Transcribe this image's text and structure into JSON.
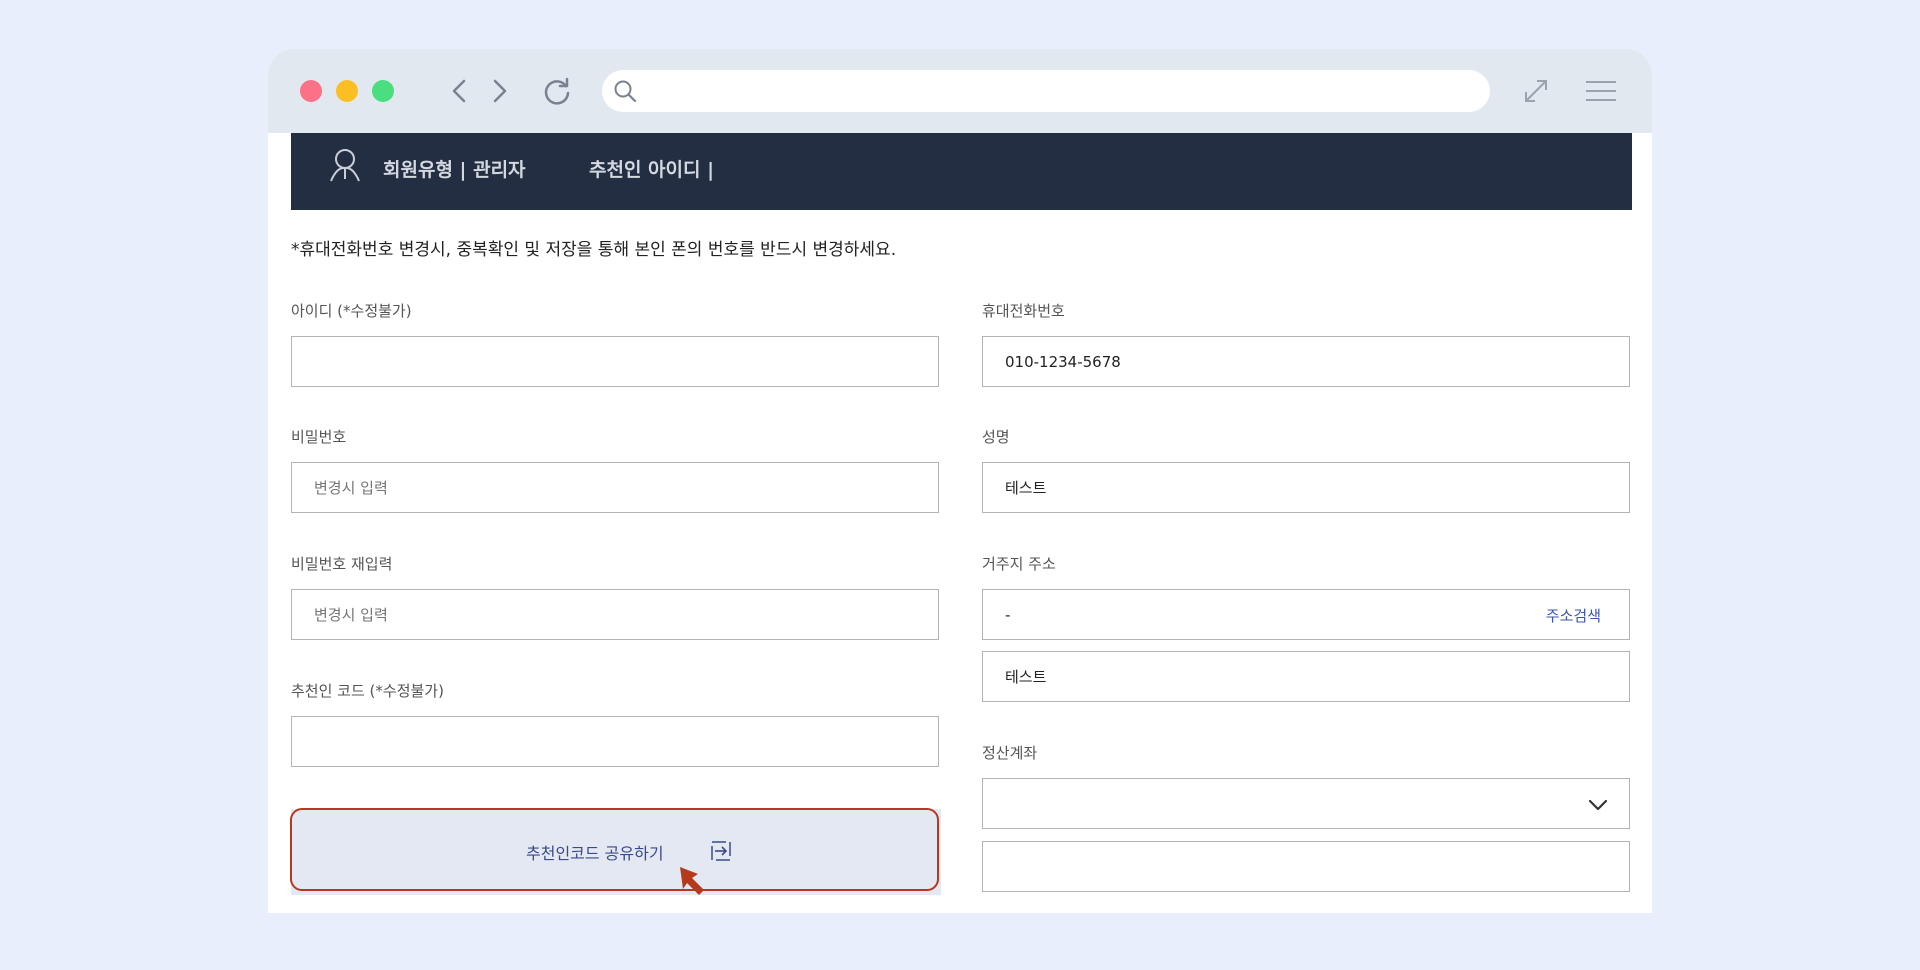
{
  "browser": {
    "url": "",
    "icons": [
      "back-icon",
      "forward-icon",
      "reload-icon",
      "search-icon",
      "expand-icon",
      "menu-icon"
    ]
  },
  "header": {
    "member_type": "회원유형 | 관리자",
    "referrer_id": "추천인 아이디 |"
  },
  "notice": "*휴대전화번호 변경시, 중복확인 및 저장을 통해 본인 폰의 번호를 반드시 변경하세요.",
  "left": {
    "id_label": "아이디 (*수정불가)",
    "id_value": "",
    "password_label": "비밀번호",
    "password_value": "변경시 입력",
    "password_confirm_label": "비밀번호 재입력",
    "password_confirm_value": "변경시 입력",
    "referral_code_label": "추천인 코드 (*수정불가)",
    "referral_code_value": "",
    "share_button": "추천인코드 공유하기"
  },
  "right": {
    "phone_label": "휴대전화번호",
    "phone_value": "010-1234-5678",
    "name_label": "성명",
    "name_value": "테스트",
    "address_label": "거주지 주소",
    "address_value": "-",
    "address_search": "주소검색",
    "address_detail_value": "테스트",
    "account_label": "정산계좌",
    "account_bank_value": "",
    "account_number_value": ""
  },
  "colors": {
    "page_bg": "#e8eefb",
    "chrome_bg": "#e2e8f0",
    "header_bg": "#242e42",
    "accent_link": "#3d55a8",
    "highlight_border": "#b53a1c",
    "cursor": "#b53a1c"
  }
}
